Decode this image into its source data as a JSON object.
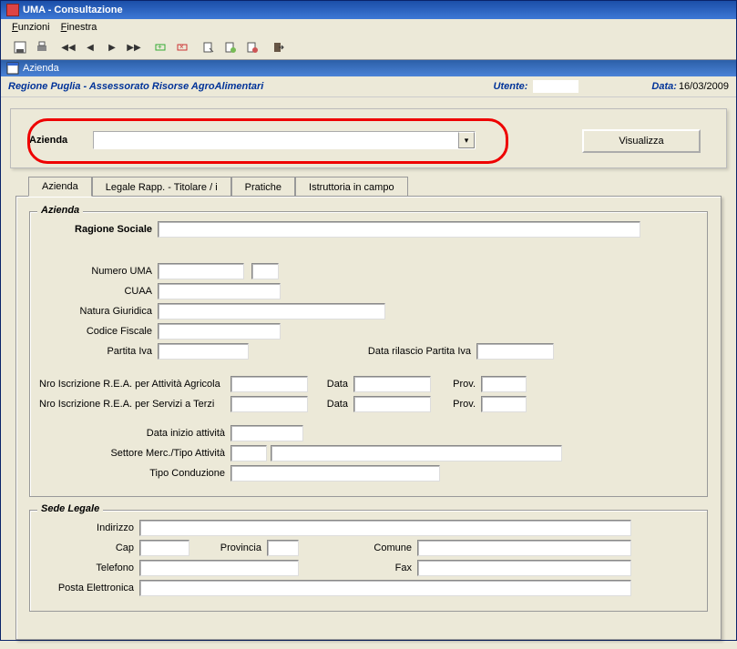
{
  "window": {
    "title": "UMA - Consultazione"
  },
  "menubar": {
    "funzioni": "Funzioni",
    "finestra": "Finestra",
    "funzioni_u": "F",
    "finestra_u": "F"
  },
  "subwindow": {
    "title": "Azienda"
  },
  "header": {
    "left": "Regione Puglia - Assessorato Risorse AgroAlimentari",
    "utente_label": "Utente:",
    "utente_value": "",
    "data_label": "Data:",
    "data_value": "16/03/2009"
  },
  "search": {
    "label": "Azienda",
    "value": "",
    "button": "Visualizza"
  },
  "tabs": {
    "t1": "Azienda",
    "t2": "Legale Rapp. - Titolare / i",
    "t3": "Pratiche",
    "t4": "Istruttoria in campo"
  },
  "groups": {
    "azienda": "Azienda",
    "sede": "Sede Legale"
  },
  "labels": {
    "ragione_sociale": "Ragione Sociale",
    "numero_uma": "Numero UMA",
    "cuaa": "CUAA",
    "natura_giuridica": "Natura Giuridica",
    "codice_fiscale": "Codice Fiscale",
    "partita_iva": "Partita Iva",
    "data_rilascio_piva": "Data rilascio Partita Iva",
    "nro_rea_agri": "Nro Iscrizione R.E.A. per Attività Agricola",
    "nro_rea_terzi": "Nro Iscrizione R.E.A. per Servizi a Terzi",
    "data": "Data",
    "prov": "Prov.",
    "data_inizio": "Data inizio attività",
    "settore": "Settore Merc./Tipo Attività",
    "tipo_cond": "Tipo Conduzione",
    "indirizzo": "Indirizzo",
    "cap": "Cap",
    "provincia": "Provincia",
    "comune": "Comune",
    "telefono": "Telefono",
    "fax": "Fax",
    "email": "Posta Elettronica"
  },
  "values": {
    "ragione_sociale": "",
    "numero_uma_a": "",
    "numero_uma_b": "",
    "cuaa": "",
    "natura_giuridica": "",
    "codice_fiscale": "",
    "partita_iva": "",
    "data_rilascio_piva": "",
    "nro_rea_agri": "",
    "rea_agri_data": "",
    "rea_agri_prov": "",
    "nro_rea_terzi": "",
    "rea_terzi_data": "",
    "rea_terzi_prov": "",
    "data_inizio": "",
    "settore_a": "",
    "settore_b": "",
    "tipo_cond": "",
    "indirizzo": "",
    "cap": "",
    "provincia": "",
    "comune": "",
    "telefono": "",
    "fax": "",
    "email": ""
  }
}
